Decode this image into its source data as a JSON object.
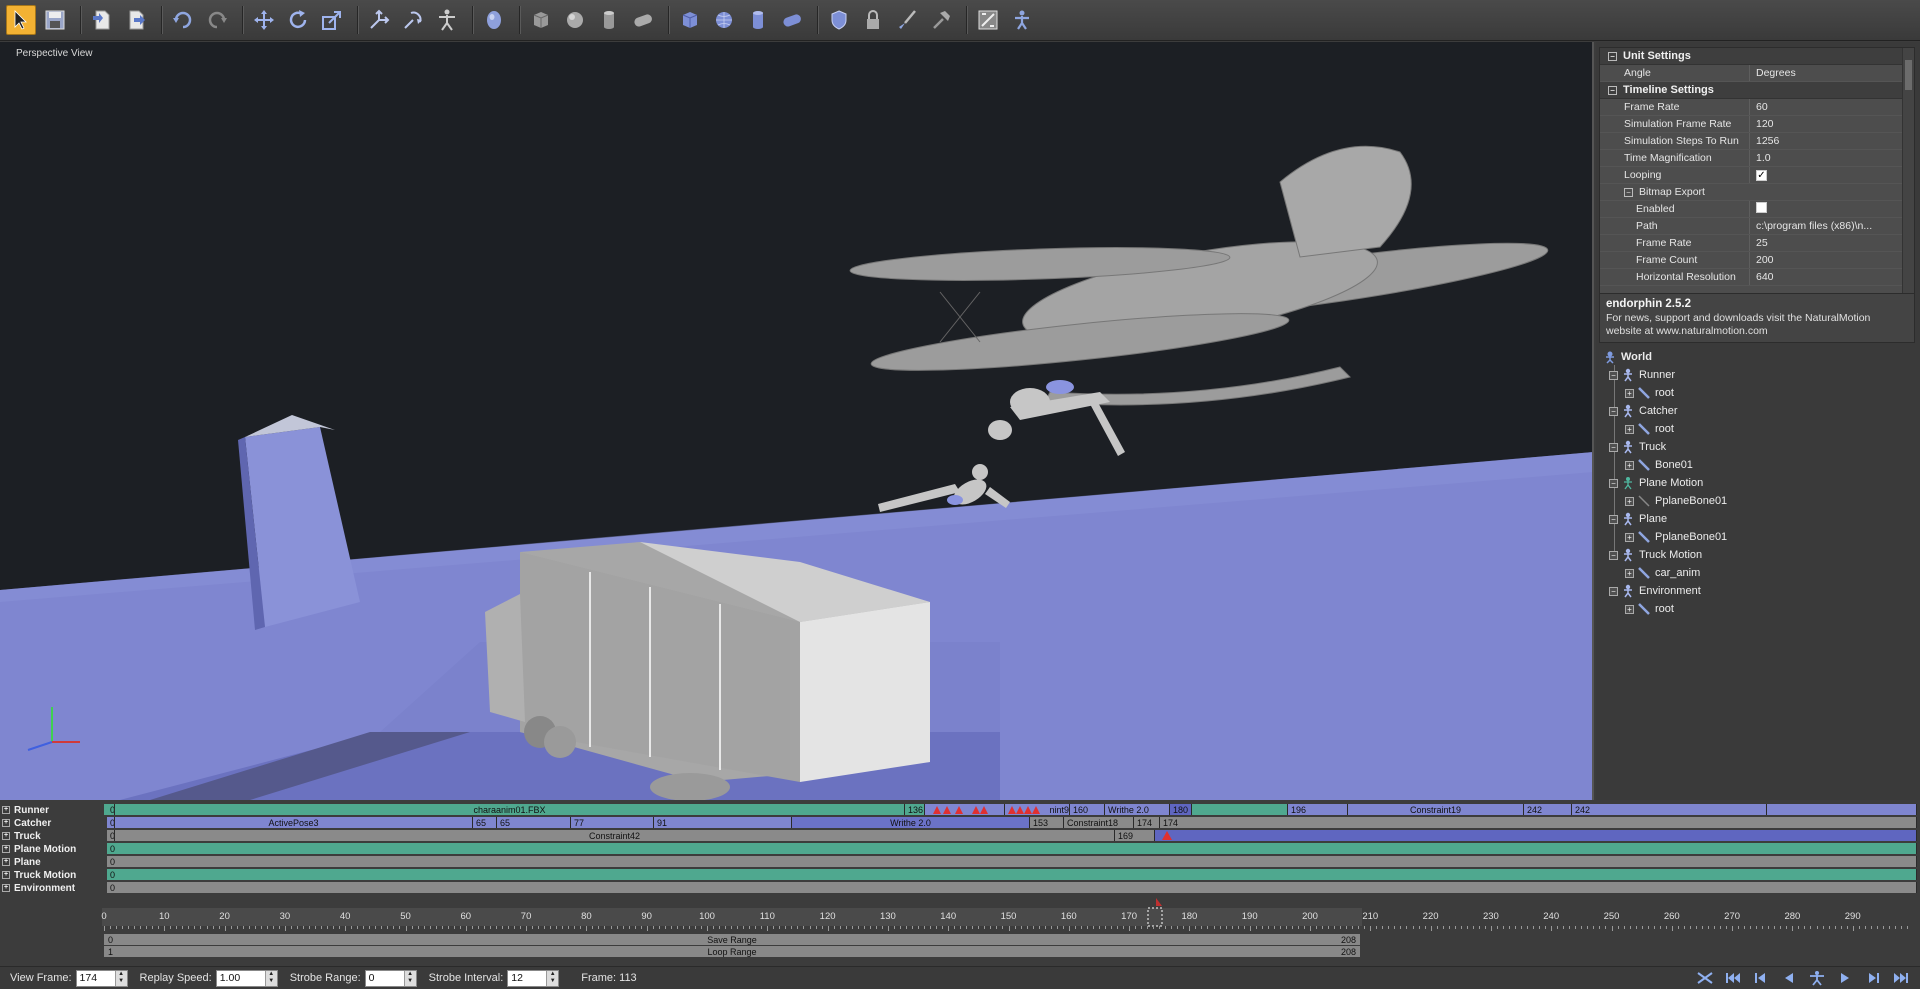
{
  "toolbar": {
    "buttons": [
      {
        "name": "select-tool",
        "icon": "arrow-cursor-icon",
        "active": true
      },
      {
        "name": "save",
        "icon": "floppy-disk-icon"
      },
      {
        "name": "import",
        "icon": "import-document-icon"
      },
      {
        "name": "export",
        "icon": "export-document-icon"
      },
      {
        "name": "undo",
        "icon": "undo-icon"
      },
      {
        "name": "redo",
        "icon": "redo-icon"
      },
      {
        "name": "move",
        "icon": "move-arrows-icon"
      },
      {
        "name": "rotate",
        "icon": "rotate-icon"
      },
      {
        "name": "scale",
        "icon": "scale-icon"
      },
      {
        "name": "bone-move",
        "icon": "bone-move-icon"
      },
      {
        "name": "bone-rotate",
        "icon": "bone-rotate-icon"
      },
      {
        "name": "character",
        "icon": "human-figure-icon"
      },
      {
        "name": "ragdoll",
        "icon": "ragdoll-head-icon"
      },
      {
        "name": "box",
        "icon": "cube-icon"
      },
      {
        "name": "sphere",
        "icon": "sphere-icon"
      },
      {
        "name": "cylinder",
        "icon": "cylinder-icon"
      },
      {
        "name": "capsule",
        "icon": "capsule-icon"
      },
      {
        "name": "box-collision",
        "icon": "blue-cube-icon"
      },
      {
        "name": "sphere-collision",
        "icon": "globe-icon"
      },
      {
        "name": "cylinder-collision",
        "icon": "blue-cylinder-icon"
      },
      {
        "name": "capsule-collision",
        "icon": "blue-capsule-icon"
      },
      {
        "name": "shield",
        "icon": "shield-icon"
      },
      {
        "name": "lock",
        "icon": "padlock-icon"
      },
      {
        "name": "brush",
        "icon": "paint-brush-icon"
      },
      {
        "name": "hammer",
        "icon": "hammer-icon"
      },
      {
        "name": "constraint",
        "icon": "constraint-icon"
      },
      {
        "name": "behaviour",
        "icon": "behaviour-icon"
      }
    ]
  },
  "viewport": {
    "label": "Perspective View",
    "background": "#1c1f24",
    "ground_color": "#7f86d0"
  },
  "properties": {
    "unit_settings": {
      "title": "Unit Settings",
      "rows": [
        {
          "name": "Angle",
          "value": "Degrees"
        }
      ]
    },
    "timeline_settings": {
      "title": "Timeline Settings",
      "rows": [
        {
          "name": "Frame Rate",
          "value": "60"
        },
        {
          "name": "Simulation Frame Rate",
          "value": "120"
        },
        {
          "name": "Simulation Steps To Run",
          "value": "1256"
        },
        {
          "name": "Time Magnification",
          "value": "1.0"
        },
        {
          "name": "Looping",
          "value": "✓"
        }
      ]
    },
    "bitmap_export": {
      "title": "Bitmap Export",
      "rows": [
        {
          "name": "Enabled",
          "value": ""
        },
        {
          "name": "Path",
          "value": "c:\\program files (x86)\\n..."
        },
        {
          "name": "Frame Rate",
          "value": "25"
        },
        {
          "name": "Frame Count",
          "value": "200"
        },
        {
          "name": "Horizontal Resolution",
          "value": "640"
        }
      ]
    }
  },
  "info": {
    "title": "endorphin 2.5.2",
    "text": "For news, support and downloads visit the NaturalMotion website at www.naturalmotion.com"
  },
  "scene_tree": {
    "root": "World",
    "items": [
      {
        "label": "Runner",
        "child": "root"
      },
      {
        "label": "Catcher",
        "child": "root"
      },
      {
        "label": "Truck",
        "child": "Bone01"
      },
      {
        "label": "Plane Motion",
        "child": "PplaneBone01"
      },
      {
        "label": "Plane",
        "child": "PplaneBone01"
      },
      {
        "label": "Truck Motion",
        "child": "car_anim"
      },
      {
        "label": "Environment",
        "child": "root"
      }
    ]
  },
  "tracks": [
    {
      "label": "Runner",
      "segments": [
        {
          "text": "0",
          "color": "#4fa88f"
        },
        {
          "text": "charaanim01.FBX",
          "color": "#4fa88f"
        },
        {
          "text": "136",
          "color": "#4fa88f"
        },
        {
          "text": "nint9",
          "color": "#7f86d0"
        },
        {
          "text": "160",
          "color": "#7f86d0"
        },
        {
          "text": "Writhe 2.0",
          "color": "#7f86d0"
        },
        {
          "text": "180",
          "color": "#7f86d0"
        },
        {
          "text": "196",
          "color": "#4fa88f"
        },
        {
          "text": "Constraint19",
          "color": "#7f86d0"
        },
        {
          "text": "242",
          "color": "#7f86d0"
        },
        {
          "text": "242",
          "color": "#7f86d0"
        }
      ]
    },
    {
      "label": "Catcher",
      "segments": [
        {
          "text": "0",
          "color": "#7f86d0"
        },
        {
          "text": "ActivePose3",
          "color": "#7f86d0"
        },
        {
          "text": "65",
          "color": "#7f86d0"
        },
        {
          "text": "65",
          "color": "#7f86d0"
        },
        {
          "text": "77",
          "color": "#7f86d0"
        },
        {
          "text": "91",
          "color": "#7f86d0"
        },
        {
          "text": "Writhe 2.0",
          "color": "#7f86d0"
        },
        {
          "text": "153",
          "color": "#8a8a8a"
        },
        {
          "text": "Constraint18",
          "color": "#8a8a8a"
        },
        {
          "text": "174",
          "color": "#8a8a8a"
        },
        {
          "text": "174",
          "color": "#8a8a8a"
        }
      ]
    },
    {
      "label": "Truck",
      "segments": [
        {
          "text": "0",
          "color": "#8a8a8a"
        },
        {
          "text": "Constraint42",
          "color": "#8a8a8a"
        },
        {
          "text": "169",
          "color": "#8a8a8a"
        }
      ]
    },
    {
      "label": "Plane Motion",
      "segments": [
        {
          "text": "0",
          "color": "#4fa88f"
        }
      ]
    },
    {
      "label": "Plane",
      "segments": [
        {
          "text": "0",
          "color": "#8a8a8a"
        }
      ]
    },
    {
      "label": "Truck Motion",
      "segments": [
        {
          "text": "0",
          "color": "#4fa88f"
        }
      ]
    },
    {
      "label": "Environment",
      "segments": [
        {
          "text": "0",
          "color": "#8a8a8a"
        }
      ]
    }
  ],
  "ruler": {
    "ticks": [
      "0",
      "10",
      "20",
      "30",
      "40",
      "50",
      "60",
      "70",
      "80",
      "90",
      "100",
      "110",
      "120",
      "130",
      "140",
      "150",
      "160",
      "170",
      "180",
      "190",
      "200",
      "210",
      "220",
      "230",
      "240",
      "250",
      "260",
      "270",
      "280",
      "290"
    ],
    "current_frame": "174",
    "save_range": {
      "label": "Save Range",
      "start": "0",
      "end": "208"
    },
    "loop_range": {
      "label": "Loop Range",
      "start": "1",
      "end": "208"
    }
  },
  "status": {
    "view_frame_label": "View Frame:",
    "view_frame_value": "174",
    "replay_speed_label": "Replay Speed:",
    "replay_speed_value": "1.00",
    "strobe_range_label": "Strobe Range:",
    "strobe_range_value": "0",
    "strobe_interval_label": "Strobe Interval:",
    "strobe_interval_value": "12",
    "frame_text": "Frame: 113"
  },
  "playback": [
    "loop-icon",
    "go-start-icon",
    "prev-key-icon",
    "step-back-icon",
    "simulate-icon",
    "play-icon",
    "step-forward-icon",
    "go-end-icon"
  ]
}
